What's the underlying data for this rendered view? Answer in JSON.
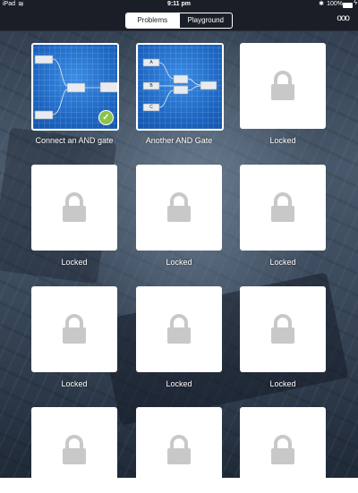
{
  "status_bar": {
    "carrier": "iPad",
    "time": "9:11 pm",
    "battery": "100%"
  },
  "nav": {
    "segments": [
      "Problems",
      "Playground"
    ],
    "selected": "Problems"
  },
  "problems": [
    {
      "label": "Connect an AND gate",
      "state": "unlocked",
      "completed": true
    },
    {
      "label": "Another AND Gate",
      "state": "unlocked",
      "completed": false
    },
    {
      "label": "Locked",
      "state": "locked"
    },
    {
      "label": "Locked",
      "state": "locked"
    },
    {
      "label": "Locked",
      "state": "locked"
    },
    {
      "label": "Locked",
      "state": "locked"
    },
    {
      "label": "Locked",
      "state": "locked"
    },
    {
      "label": "Locked",
      "state": "locked"
    },
    {
      "label": "Locked",
      "state": "locked"
    },
    {
      "label": "",
      "state": "locked"
    },
    {
      "label": "",
      "state": "locked"
    },
    {
      "label": "",
      "state": "locked"
    }
  ],
  "tile2_inputs": [
    "A",
    "B",
    "C"
  ],
  "colors": {
    "accent_blue": "#1e6fd0",
    "success_green": "#8bc34a",
    "lock_gray": "#c8c8c8"
  }
}
